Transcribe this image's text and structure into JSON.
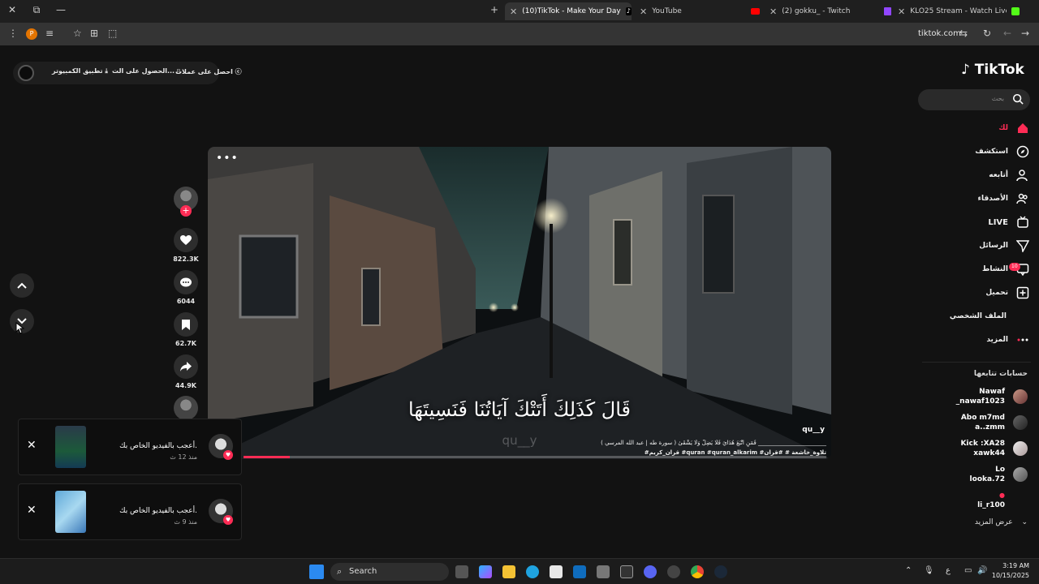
{
  "browser": {
    "tabs": [
      {
        "title": "(10)TikTok - Make Your Day",
        "active": true
      },
      {
        "title": "YouTube",
        "active": false
      },
      {
        "title": "(2) gokku_ - Twitch",
        "active": false
      },
      {
        "title": "KLO25 Stream - Watch Live on",
        "active": false
      }
    ],
    "url": "tiktok.com",
    "profile_letter": "P"
  },
  "topbar": {
    "links": [
      "احصل على عملات",
      "الحصول على الت...",
      "تطبيق الكمبيوتر"
    ]
  },
  "brand": {
    "logo": "TikTok",
    "accent": "#fe2c55"
  },
  "search": {
    "placeholder": "بحث"
  },
  "nav": [
    {
      "label": "لك",
      "icon": "home-icon",
      "active": true
    },
    {
      "label": "استكشف",
      "icon": "compass-icon"
    },
    {
      "label": "أتابعه",
      "icon": "following-icon"
    },
    {
      "label": "الأصدقاء",
      "icon": "friends-icon"
    },
    {
      "label": "LIVE",
      "icon": "live-icon"
    },
    {
      "label": "الرسائل",
      "icon": "messages-icon"
    },
    {
      "label": "النشاط",
      "icon": "activity-icon",
      "badge": "10"
    },
    {
      "label": "تحميل",
      "icon": "upload-icon"
    },
    {
      "label": "الملف الشخصي",
      "icon": "profile-icon"
    },
    {
      "label": "المزيد",
      "icon": "more-icon"
    }
  ],
  "following": {
    "heading": "حسابات تتابعها",
    "accounts": [
      {
        "name": "Nawaf",
        "handle": "_nawaf1023"
      },
      {
        "name": "Abo m7md",
        "handle": "a..zmm"
      },
      {
        "name": "Kick :XA28",
        "handle": "xawk44"
      },
      {
        "name": "Lo",
        "handle": "looka.72"
      },
      {
        "name": "",
        "handle": "li_r100"
      }
    ],
    "show_more": "عرض المزيد"
  },
  "video": {
    "subtitle": "قَالَ كَذَلِكَ أَتَتْكَ آيَاتُنَا فَنَسِيتَهَا",
    "watermark": "qu__y",
    "author": "qu__y",
    "description": "فَمَنِ اتَّبَعَ هُدَايَ فَلَا يَضِلُّ وَلَا يَشْقَىٰ ( سورة طه | عبد الله المرسي ) ________________________",
    "tags": "#قران_كريم #quran #quran_alkarim #تلاوة_خاشعة # #قران",
    "progress": 0.08
  },
  "actions": {
    "likes": "822.3K",
    "comments": "6044",
    "saves": "62.7K",
    "shares": "44.9K"
  },
  "notifications": [
    {
      "text": "أعجب بالفيديو الخاص بك.",
      "ago": "منذ 12 ث"
    },
    {
      "text": "أعجب بالفيديو الخاص بك.",
      "ago": "منذ 9 ث"
    }
  ],
  "taskbar": {
    "search": "Search",
    "time": "3:19 AM",
    "date": "10/15/2025",
    "lang": "ع"
  }
}
